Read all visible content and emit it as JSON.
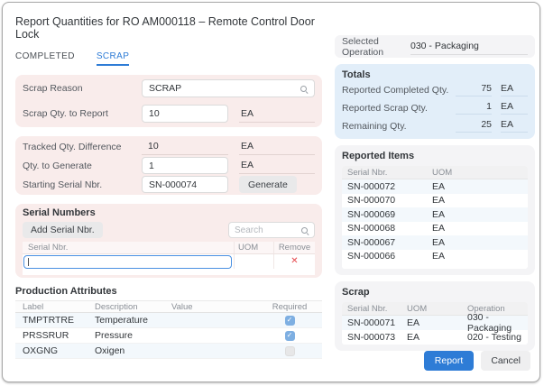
{
  "dialog": {
    "title": "Report Quantities for RO AM000118 – Remote Control Door Lock"
  },
  "tabs": [
    {
      "label": "COMPLETED",
      "active": false
    },
    {
      "label": "SCRAP",
      "active": true
    }
  ],
  "scrap_form": {
    "scrap_reason": {
      "label": "Scrap Reason",
      "value": "SCRAP"
    },
    "scrap_qty": {
      "label": "Scrap Qty. to Report",
      "value": "10",
      "uom": "EA"
    }
  },
  "generate_form": {
    "tracked_qty": {
      "label": "Tracked Qty. Difference",
      "value": "10",
      "uom": "EA"
    },
    "qty_to_generate": {
      "label": "Qty. to Generate",
      "value": "1",
      "uom": "EA"
    },
    "starting_serial": {
      "label": "Starting Serial Nbr.",
      "value": "SN-000074",
      "button": "Generate"
    }
  },
  "serial_numbers": {
    "title": "Serial Numbers",
    "add_button": "Add Serial Nbr.",
    "search_placeholder": "Search",
    "columns": {
      "serial": "Serial Nbr.",
      "uom": "UOM",
      "remove": "Remove"
    },
    "rows": [
      {
        "serial": "",
        "uom": ""
      }
    ]
  },
  "production_attributes": {
    "title": "Production Attributes",
    "columns": {
      "label": "Label",
      "description": "Description",
      "value": "Value",
      "required": "Required"
    },
    "rows": [
      {
        "label": "TMPTRTRE",
        "description": "Temperature",
        "value": "",
        "required": true
      },
      {
        "label": "PRSSRUR",
        "description": "Pressure",
        "value": "",
        "required": true
      },
      {
        "label": "OXGNG",
        "description": "Oxigen",
        "value": "",
        "required": false
      }
    ]
  },
  "selected_operation": {
    "label": "Selected Operation",
    "value": "030 - Packaging"
  },
  "totals": {
    "title": "Totals",
    "rows": [
      {
        "label": "Reported Completed Qty.",
        "value": "75",
        "uom": "EA"
      },
      {
        "label": "Reported Scrap Qty.",
        "value": "1",
        "uom": "EA"
      },
      {
        "label": "Remaining Qty.",
        "value": "25",
        "uom": "EA"
      }
    ]
  },
  "reported_items": {
    "title": "Reported Items",
    "columns": {
      "serial": "Serial Nbr.",
      "uom": "UOM"
    },
    "rows": [
      {
        "serial": "SN-000072",
        "uom": "EA"
      },
      {
        "serial": "SN-000070",
        "uom": "EA"
      },
      {
        "serial": "SN-000069",
        "uom": "EA"
      },
      {
        "serial": "SN-000068",
        "uom": "EA"
      },
      {
        "serial": "SN-000067",
        "uom": "EA"
      },
      {
        "serial": "SN-000066",
        "uom": "EA"
      }
    ]
  },
  "scrap_items": {
    "title": "Scrap",
    "columns": {
      "serial": "Serial Nbr.",
      "uom": "UOM",
      "operation": "Operation"
    },
    "rows": [
      {
        "serial": "SN-000071",
        "uom": "EA",
        "operation": "030 - Packaging"
      },
      {
        "serial": "SN-000073",
        "uom": "EA",
        "operation": "020 - Testing"
      }
    ]
  },
  "footer": {
    "report": "Report",
    "cancel": "Cancel"
  },
  "icons": {
    "remove": "✕",
    "check": "✓"
  },
  "colors": {
    "accent_blue": "#2e7cd6",
    "panel_pink": "#f9eceb",
    "panel_blue": "#e2eef9",
    "panel_gray": "#f4f4f6",
    "row_stripe": "#f3f8fc",
    "danger_red": "#e5484d",
    "checkbox_checked": "#7eafe2",
    "focus_border": "#4a90e2"
  }
}
